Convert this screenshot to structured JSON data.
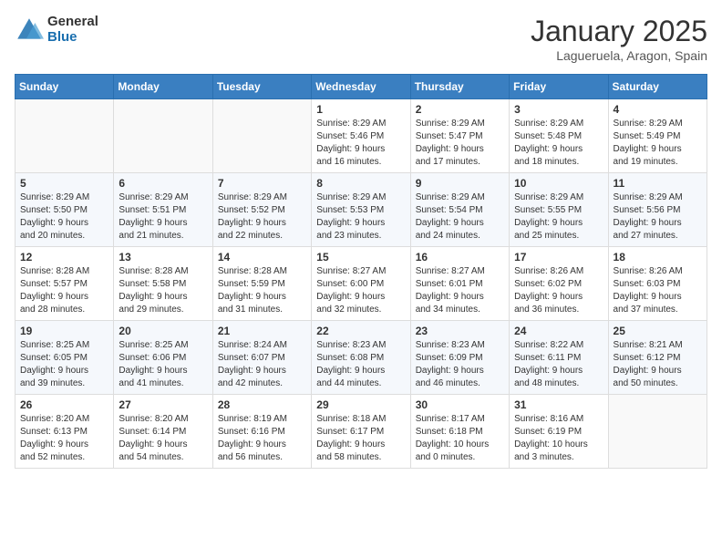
{
  "logo": {
    "general": "General",
    "blue": "Blue"
  },
  "header": {
    "month": "January 2025",
    "location": "Lagueruela, Aragon, Spain"
  },
  "weekdays": [
    "Sunday",
    "Monday",
    "Tuesday",
    "Wednesday",
    "Thursday",
    "Friday",
    "Saturday"
  ],
  "weeks": [
    [
      {
        "day": "",
        "info": ""
      },
      {
        "day": "",
        "info": ""
      },
      {
        "day": "",
        "info": ""
      },
      {
        "day": "1",
        "info": "Sunrise: 8:29 AM\nSunset: 5:46 PM\nDaylight: 9 hours\nand 16 minutes."
      },
      {
        "day": "2",
        "info": "Sunrise: 8:29 AM\nSunset: 5:47 PM\nDaylight: 9 hours\nand 17 minutes."
      },
      {
        "day": "3",
        "info": "Sunrise: 8:29 AM\nSunset: 5:48 PM\nDaylight: 9 hours\nand 18 minutes."
      },
      {
        "day": "4",
        "info": "Sunrise: 8:29 AM\nSunset: 5:49 PM\nDaylight: 9 hours\nand 19 minutes."
      }
    ],
    [
      {
        "day": "5",
        "info": "Sunrise: 8:29 AM\nSunset: 5:50 PM\nDaylight: 9 hours\nand 20 minutes."
      },
      {
        "day": "6",
        "info": "Sunrise: 8:29 AM\nSunset: 5:51 PM\nDaylight: 9 hours\nand 21 minutes."
      },
      {
        "day": "7",
        "info": "Sunrise: 8:29 AM\nSunset: 5:52 PM\nDaylight: 9 hours\nand 22 minutes."
      },
      {
        "day": "8",
        "info": "Sunrise: 8:29 AM\nSunset: 5:53 PM\nDaylight: 9 hours\nand 23 minutes."
      },
      {
        "day": "9",
        "info": "Sunrise: 8:29 AM\nSunset: 5:54 PM\nDaylight: 9 hours\nand 24 minutes."
      },
      {
        "day": "10",
        "info": "Sunrise: 8:29 AM\nSunset: 5:55 PM\nDaylight: 9 hours\nand 25 minutes."
      },
      {
        "day": "11",
        "info": "Sunrise: 8:29 AM\nSunset: 5:56 PM\nDaylight: 9 hours\nand 27 minutes."
      }
    ],
    [
      {
        "day": "12",
        "info": "Sunrise: 8:28 AM\nSunset: 5:57 PM\nDaylight: 9 hours\nand 28 minutes."
      },
      {
        "day": "13",
        "info": "Sunrise: 8:28 AM\nSunset: 5:58 PM\nDaylight: 9 hours\nand 29 minutes."
      },
      {
        "day": "14",
        "info": "Sunrise: 8:28 AM\nSunset: 5:59 PM\nDaylight: 9 hours\nand 31 minutes."
      },
      {
        "day": "15",
        "info": "Sunrise: 8:27 AM\nSunset: 6:00 PM\nDaylight: 9 hours\nand 32 minutes."
      },
      {
        "day": "16",
        "info": "Sunrise: 8:27 AM\nSunset: 6:01 PM\nDaylight: 9 hours\nand 34 minutes."
      },
      {
        "day": "17",
        "info": "Sunrise: 8:26 AM\nSunset: 6:02 PM\nDaylight: 9 hours\nand 36 minutes."
      },
      {
        "day": "18",
        "info": "Sunrise: 8:26 AM\nSunset: 6:03 PM\nDaylight: 9 hours\nand 37 minutes."
      }
    ],
    [
      {
        "day": "19",
        "info": "Sunrise: 8:25 AM\nSunset: 6:05 PM\nDaylight: 9 hours\nand 39 minutes."
      },
      {
        "day": "20",
        "info": "Sunrise: 8:25 AM\nSunset: 6:06 PM\nDaylight: 9 hours\nand 41 minutes."
      },
      {
        "day": "21",
        "info": "Sunrise: 8:24 AM\nSunset: 6:07 PM\nDaylight: 9 hours\nand 42 minutes."
      },
      {
        "day": "22",
        "info": "Sunrise: 8:23 AM\nSunset: 6:08 PM\nDaylight: 9 hours\nand 44 minutes."
      },
      {
        "day": "23",
        "info": "Sunrise: 8:23 AM\nSunset: 6:09 PM\nDaylight: 9 hours\nand 46 minutes."
      },
      {
        "day": "24",
        "info": "Sunrise: 8:22 AM\nSunset: 6:11 PM\nDaylight: 9 hours\nand 48 minutes."
      },
      {
        "day": "25",
        "info": "Sunrise: 8:21 AM\nSunset: 6:12 PM\nDaylight: 9 hours\nand 50 minutes."
      }
    ],
    [
      {
        "day": "26",
        "info": "Sunrise: 8:20 AM\nSunset: 6:13 PM\nDaylight: 9 hours\nand 52 minutes."
      },
      {
        "day": "27",
        "info": "Sunrise: 8:20 AM\nSunset: 6:14 PM\nDaylight: 9 hours\nand 54 minutes."
      },
      {
        "day": "28",
        "info": "Sunrise: 8:19 AM\nSunset: 6:16 PM\nDaylight: 9 hours\nand 56 minutes."
      },
      {
        "day": "29",
        "info": "Sunrise: 8:18 AM\nSunset: 6:17 PM\nDaylight: 9 hours\nand 58 minutes."
      },
      {
        "day": "30",
        "info": "Sunrise: 8:17 AM\nSunset: 6:18 PM\nDaylight: 10 hours\nand 0 minutes."
      },
      {
        "day": "31",
        "info": "Sunrise: 8:16 AM\nSunset: 6:19 PM\nDaylight: 10 hours\nand 3 minutes."
      },
      {
        "day": "",
        "info": ""
      }
    ]
  ]
}
